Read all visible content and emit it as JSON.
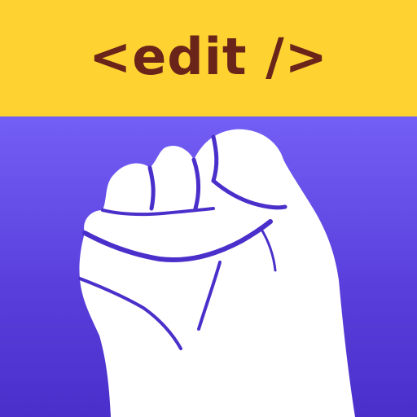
{
  "app_icon": {
    "banner_text": "<edit />",
    "symbol": "raised-fist-icon",
    "colors": {
      "banner_background": "#FDD231",
      "banner_text": "#6B2419",
      "field_top": "#735FF5",
      "field_bottom": "#4B2FCB",
      "fist_fill": "#FFFFFF",
      "fist_lines": "#4B2FCB"
    }
  }
}
